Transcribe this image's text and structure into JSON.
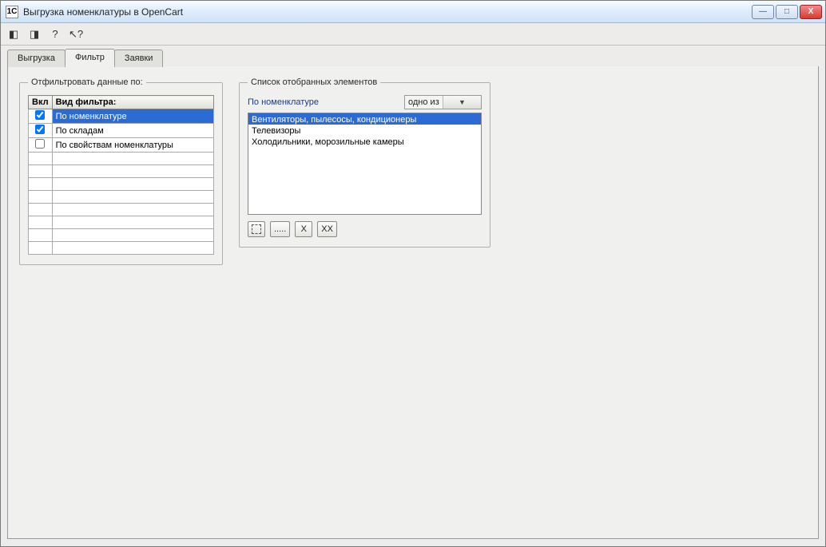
{
  "window": {
    "title": "Выгрузка номенклатуры в OpenCart",
    "icon_label": "1C"
  },
  "toolbar": {
    "buttons": [
      {
        "name": "tool-switch-a",
        "glyph": "◧"
      },
      {
        "name": "tool-switch-b",
        "glyph": "◨"
      },
      {
        "name": "tool-help",
        "glyph": "?"
      },
      {
        "name": "tool-pointer",
        "glyph": "↖?"
      }
    ]
  },
  "tabs": {
    "items": [
      {
        "name": "tab-export",
        "label": "Выгрузка",
        "active": false
      },
      {
        "name": "tab-filter",
        "label": "Фильтр",
        "active": true
      },
      {
        "name": "tab-requests",
        "label": "Заявки",
        "active": false
      }
    ]
  },
  "filter_group": {
    "legend": "Отфильтровать данные по:",
    "columns": {
      "enabled": "Вкл",
      "type": "Вид фильтра:"
    },
    "rows": [
      {
        "enabled": true,
        "label": "По номенклатуре",
        "selected": true
      },
      {
        "enabled": true,
        "label": "По складам",
        "selected": false
      },
      {
        "enabled": false,
        "label": "По свойствам номенклатуры",
        "selected": false
      }
    ],
    "blank_rows": 8
  },
  "selected_group": {
    "legend": "Список отобранных элементов",
    "header_label": "По номенклатуре",
    "mode_selected": "одно из",
    "items": [
      {
        "label": "Вентиляторы, пылесосы, кондиционеры",
        "selected": true
      },
      {
        "label": "Телевизоры",
        "selected": false
      },
      {
        "label": "Холодильники, морозильные камеры",
        "selected": false
      }
    ],
    "buttons": {
      "pick_one": "",
      "pick_many": ".....",
      "remove_one": "X",
      "remove_all": "XX"
    }
  },
  "win_controls": {
    "minimize": "—",
    "maximize": "□",
    "close": "X"
  }
}
